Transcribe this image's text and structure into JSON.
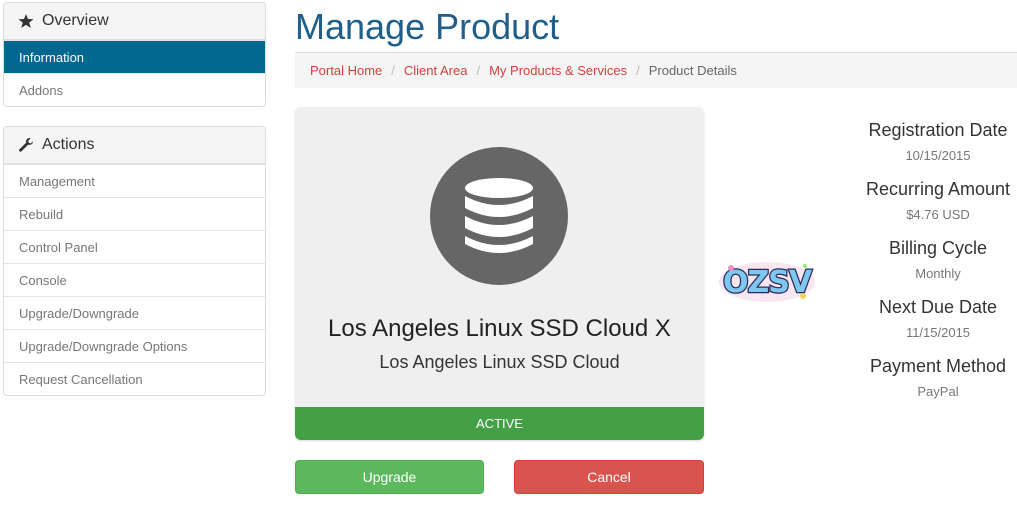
{
  "sidebar": {
    "overview": {
      "heading": "Overview",
      "items": [
        {
          "label": "Information"
        },
        {
          "label": "Addons"
        }
      ]
    },
    "actions": {
      "heading": "Actions",
      "items": [
        {
          "label": "Management"
        },
        {
          "label": "Rebuild"
        },
        {
          "label": "Control Panel"
        },
        {
          "label": "Console"
        },
        {
          "label": "Upgrade/Downgrade"
        },
        {
          "label": "Upgrade/Downgrade Options"
        },
        {
          "label": "Request Cancellation"
        }
      ]
    }
  },
  "page": {
    "title": "Manage Product"
  },
  "breadcrumb": {
    "items": [
      {
        "label": "Portal Home"
      },
      {
        "label": "Client Area"
      },
      {
        "label": "My Products & Services"
      }
    ],
    "current": "Product Details"
  },
  "product": {
    "name": "Los Angeles Linux SSD Cloud X",
    "group": "Los Angeles Linux SSD Cloud",
    "status": "ACTIVE",
    "icon": "database-icon"
  },
  "buttons": {
    "upgrade": "Upgrade",
    "cancel": "Cancel"
  },
  "logo": {
    "text": "OZSV"
  },
  "details": [
    {
      "label": "Registration Date",
      "value": "10/15/2015"
    },
    {
      "label": "Recurring Amount",
      "value": "$4.76 USD"
    },
    {
      "label": "Billing Cycle",
      "value": "Monthly"
    },
    {
      "label": "Next Due Date",
      "value": "11/15/2015"
    },
    {
      "label": "Payment Method",
      "value": "PayPal"
    }
  ],
  "colors": {
    "active_menu": "#00678f",
    "title": "#1f5f8a",
    "link": "#d43f3a",
    "status_active": "#43a047",
    "upgrade_button": "#5cb85c",
    "cancel_button": "#d9534f"
  }
}
